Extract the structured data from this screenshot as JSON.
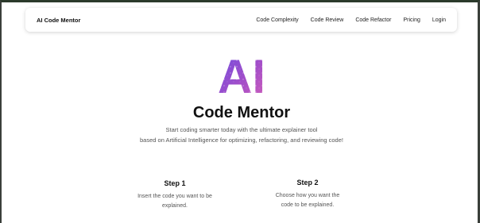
{
  "navbar": {
    "brand": "AI Code Mentor",
    "links": [
      "Code Complexity",
      "Code Review",
      "Code Refactor",
      "Pricing",
      "Login"
    ]
  },
  "hero": {
    "logo_text": "AI",
    "title": "Code Mentor",
    "subtitle_line1": "Start coding smarter today with the ultimate explainer tool",
    "subtitle_line2": "based on Artificial Intelligence for optimizing, refactoring, and reviewing code!"
  },
  "steps": [
    {
      "title": "Step 1",
      "line1": "Insert the code you want to be",
      "line2": "explained."
    },
    {
      "title": "Step 2",
      "line1": "Choose how you want the",
      "line2": "code to be explained."
    }
  ],
  "colors": {
    "logo_gradient_start": "#6f4fe0",
    "logo_gradient_mid": "#a24ec9",
    "logo_gradient_end": "#d15fb9",
    "frame_border": "#3a3f3a"
  }
}
